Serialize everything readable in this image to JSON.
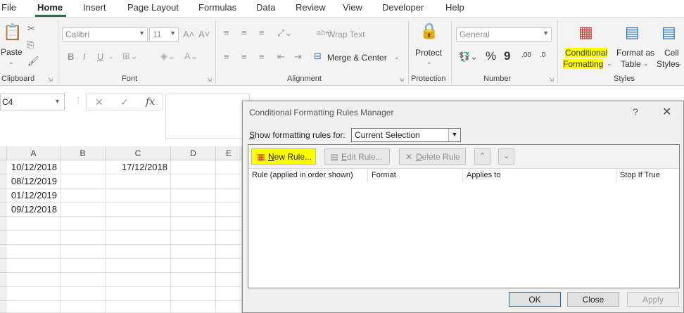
{
  "menu": {
    "items": [
      "File",
      "Home",
      "Insert",
      "Page Layout",
      "Formulas",
      "Data",
      "Review",
      "View",
      "Developer",
      "Help"
    ],
    "active": "Home"
  },
  "ribbon": {
    "clipboard": {
      "paste": "Paste",
      "label": "Clipboard"
    },
    "font": {
      "font_name": "Calibri",
      "font_size": "11",
      "bold": "B",
      "italic": "I",
      "underline": "U",
      "label": "Font"
    },
    "alignment": {
      "wrap_text": "Wrap Text",
      "merge_center": "Merge & Center",
      "label": "Alignment"
    },
    "protection": {
      "protect": "Protect",
      "label": "Protection"
    },
    "number": {
      "format": "General",
      "percent": "%",
      "comma": "9",
      "inc_decimal": ".00",
      "dec_decimal": ".0",
      "label": "Number"
    },
    "styles": {
      "conditional_formatting_line1": "Conditional",
      "conditional_formatting_line2": "Formatting",
      "format_as_table_line1": "Format as",
      "format_as_table_line2": "Table",
      "cell_styles_line1": "Cell",
      "cell_styles_line2": "Styles",
      "label": "Styles"
    },
    "colors": {
      "highlight": "#ffff00",
      "excel_green": "#217346"
    }
  },
  "formula_bar": {
    "name_box": "C4",
    "cancel": "✕",
    "enter": "✓",
    "fx": "fx",
    "value": ""
  },
  "grid": {
    "columns": [
      "A",
      "B",
      "C",
      "D",
      "E"
    ],
    "rows": [
      {
        "A": "10/12/2018",
        "C": "17/12/2018"
      },
      {
        "A": "08/12/2019"
      },
      {
        "A": "01/12/2019"
      },
      {
        "A": "09/12/2018"
      }
    ]
  },
  "dialog": {
    "title": "Conditional Formatting Rules Manager",
    "help": "?",
    "close": "✕",
    "show_rules_label_key": "S",
    "show_rules_label_rest": "how formatting rules for:",
    "show_rules_value": "Current Selection",
    "toolbar": {
      "new_rule_key": "N",
      "new_rule_rest": "ew Rule...",
      "edit_rule_key": "E",
      "edit_rule_rest": "dit Rule...",
      "delete_rule_key": "D",
      "delete_rule_rest": "elete Rule"
    },
    "list_columns": [
      "Rule (applied in order shown)",
      "Format",
      "Applies to",
      "Stop If True"
    ],
    "buttons": {
      "ok": "OK",
      "close": "Close",
      "apply": "Apply"
    }
  }
}
